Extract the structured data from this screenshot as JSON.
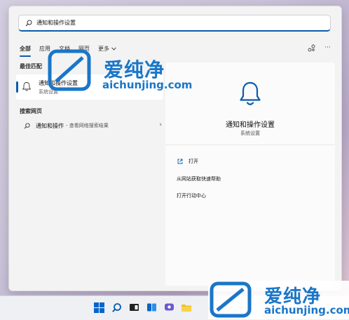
{
  "search": {
    "value": "通知和操作设置"
  },
  "tabs": [
    {
      "label": "全部"
    },
    {
      "label": "应用"
    },
    {
      "label": "文档"
    },
    {
      "label": "网页"
    },
    {
      "label": "更多"
    }
  ],
  "left": {
    "best_match_heading": "最佳匹配",
    "best_match": {
      "title": "通知和操作设置",
      "subtitle": "系统设置"
    },
    "web_heading": "搜索网页",
    "web_item": {
      "query": "通知和操作",
      "detail": "- 查看网络搜索结果"
    }
  },
  "right": {
    "title": "通知和操作设置",
    "subtitle": "系统设置",
    "actions": [
      {
        "label": "打开"
      },
      {
        "label": "从网站获取快速帮助"
      },
      {
        "label": "打开行动中心"
      }
    ]
  },
  "watermark": {
    "brand": "爱纯净",
    "url": "aichunjing.com"
  },
  "icons": {
    "search": "search-icon",
    "bell": "bell-icon",
    "more": "more-icon",
    "share": "share-icon",
    "open": "open-icon"
  },
  "colors": {
    "accent": "#0b5cad",
    "watermark": "#1a76c8"
  }
}
